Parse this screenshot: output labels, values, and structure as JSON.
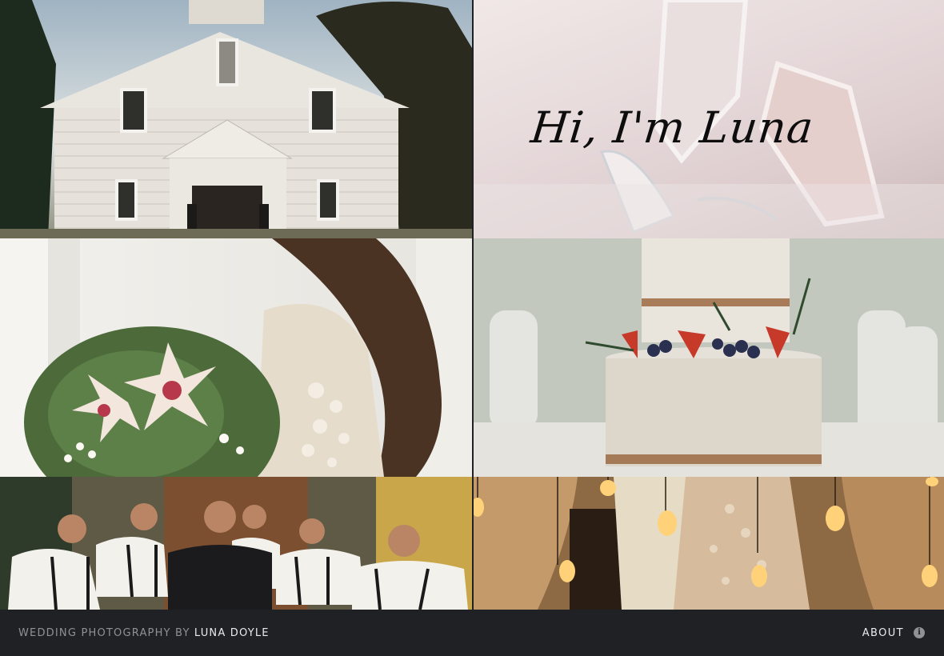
{
  "hero": {
    "greeting": "Hi, I'm Luna"
  },
  "gallery": {
    "photos": [
      {
        "subject": "white wooden church"
      },
      {
        "subject": "bridal shoes"
      },
      {
        "subject": "bride with lily bouquet"
      },
      {
        "subject": "naked wedding cake with berries"
      },
      {
        "subject": "groom and groomsmen"
      },
      {
        "subject": "couple under edison bulbs"
      }
    ]
  },
  "footer": {
    "brand_prefix": "WEDDING PHOTOGRAPHY BY ",
    "brand_name": "LUNA DOYLE",
    "about_label": "ABOUT",
    "info_glyph": "i"
  },
  "colors": {
    "footer_bg": "#1f2124",
    "footer_text_muted": "#8e9196",
    "footer_text_bright": "#e9eaec"
  }
}
